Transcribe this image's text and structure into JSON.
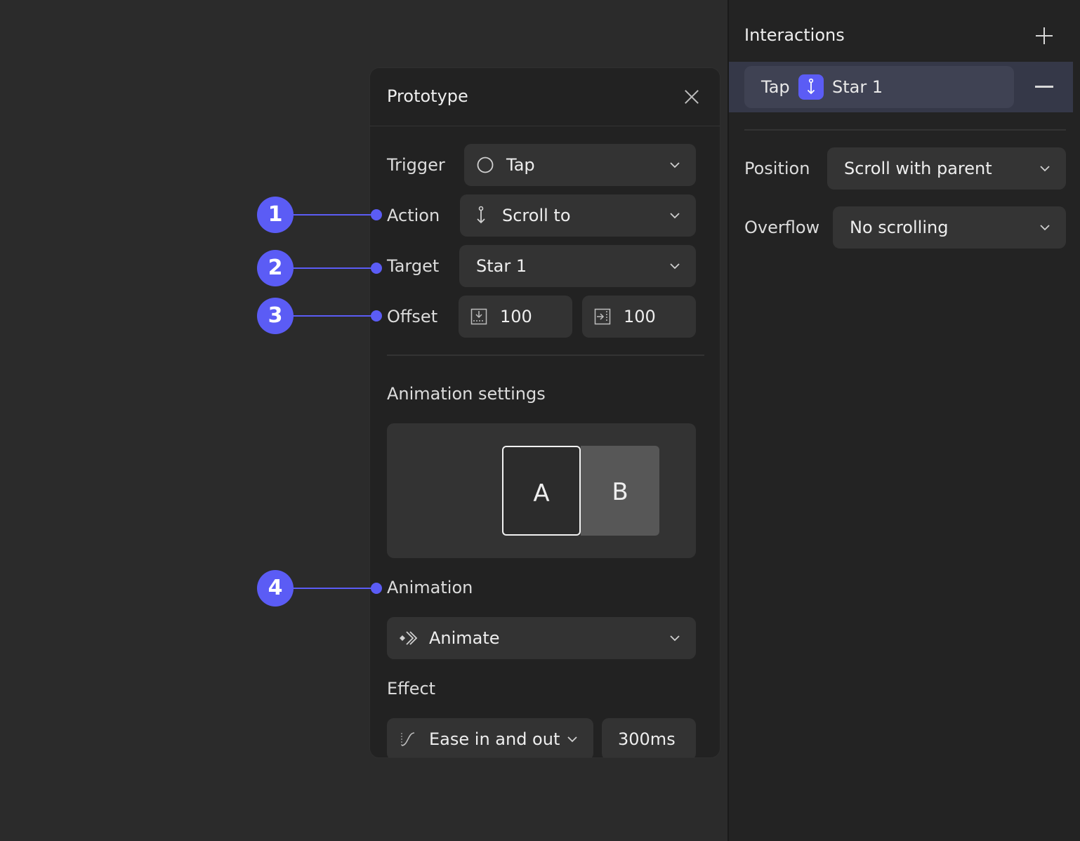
{
  "prototype": {
    "title": "Prototype",
    "trigger": {
      "label": "Trigger",
      "value": "Tap"
    },
    "action": {
      "label": "Action",
      "value": "Scroll to"
    },
    "target": {
      "label": "Target",
      "value": "Star 1"
    },
    "offset": {
      "label": "Offset",
      "x": "100",
      "y": "100"
    },
    "animation_settings": {
      "heading": "Animation settings",
      "preview_a": "A",
      "preview_b": "B"
    },
    "animation": {
      "label": "Animation",
      "value": "Animate"
    },
    "effect": {
      "label": "Effect",
      "easing": "Ease in and out",
      "duration": "300ms"
    }
  },
  "callouts": [
    "1",
    "2",
    "3",
    "4"
  ],
  "inspector": {
    "title": "Interactions",
    "interaction": {
      "trigger": "Tap",
      "target": "Star 1"
    },
    "position": {
      "label": "Position",
      "value": "Scroll with parent"
    },
    "overflow": {
      "label": "Overflow",
      "value": "No scrolling"
    }
  },
  "colors": {
    "accent": "#5b5cf5",
    "canvas": "#2b2b2b",
    "panel": "#222222",
    "field": "#333333"
  },
  "icons": {
    "trigger": "circle-icon",
    "action": "scroll-to-icon",
    "offset_x": "offset-vertical-icon",
    "offset_y": "offset-horizontal-icon",
    "animation": "animate-icon",
    "easing": "ease-curve-icon"
  }
}
